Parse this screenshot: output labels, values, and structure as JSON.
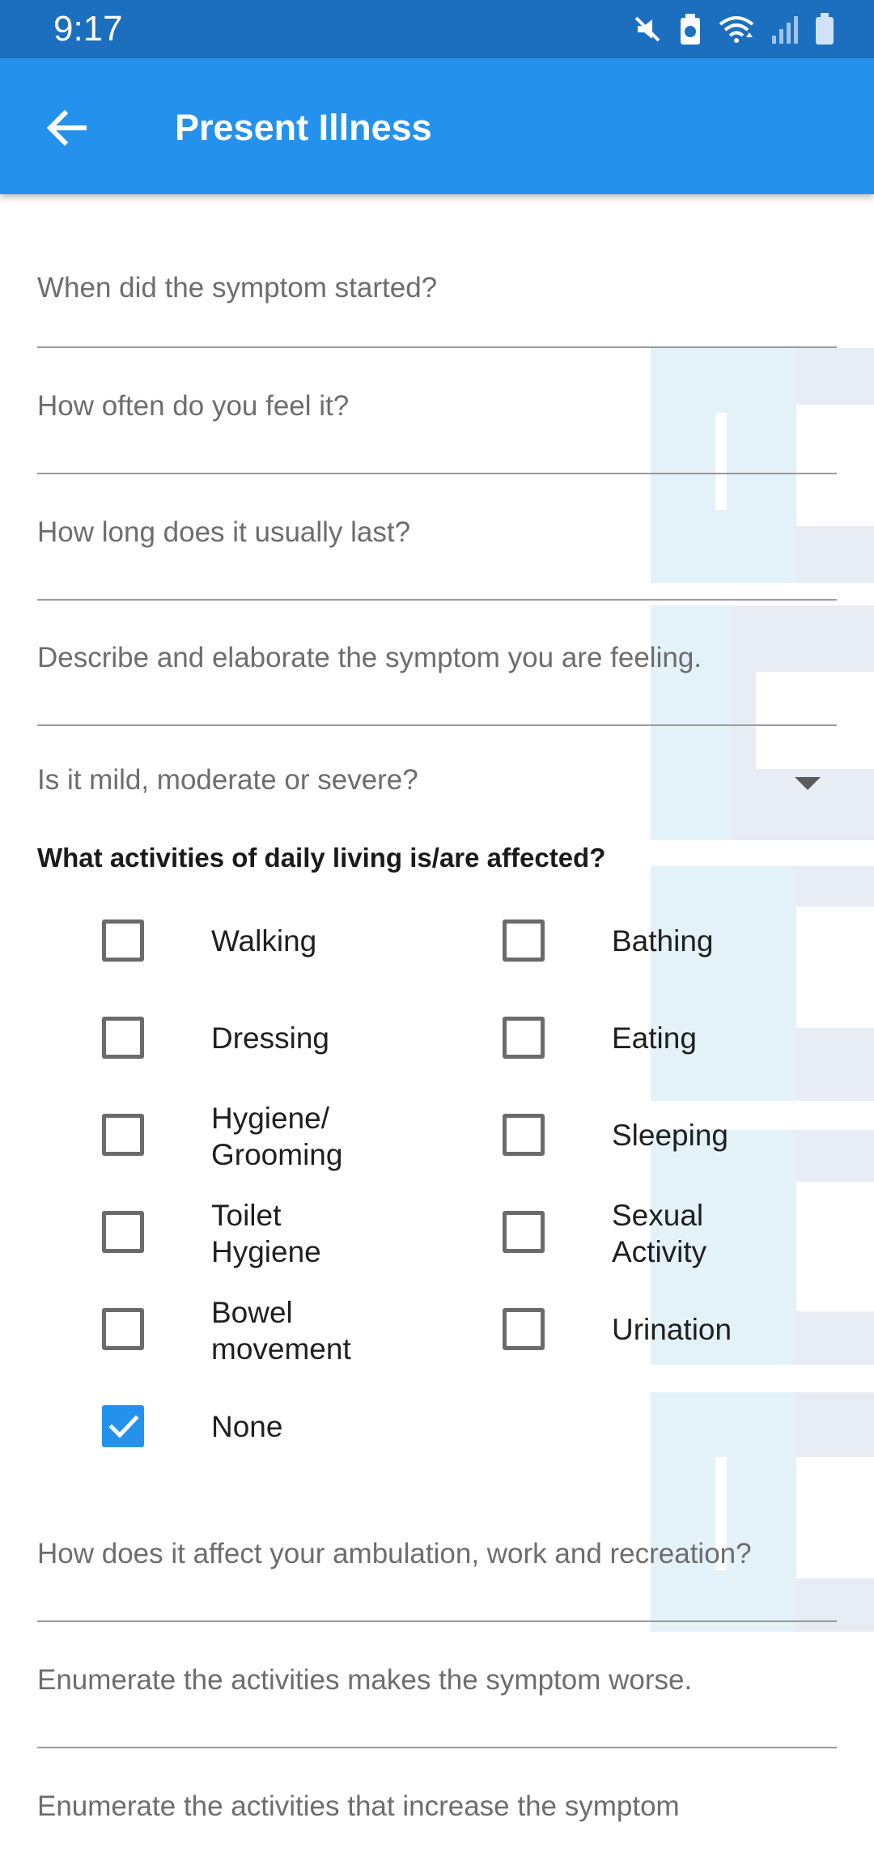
{
  "status_bar": {
    "time": "9:17",
    "icons": [
      "mute-icon",
      "battery-saver-icon",
      "wifi-icon",
      "signal-icon",
      "battery-icon"
    ]
  },
  "app_bar": {
    "title": "Present Illness",
    "back_icon": "back-arrow-icon"
  },
  "fields": {
    "symptom_started": {
      "placeholder": "When did the symptom started?",
      "value": ""
    },
    "how_often": {
      "placeholder": "How often do you feel it?",
      "value": ""
    },
    "how_long": {
      "placeholder": "How long does it usually last?",
      "value": ""
    },
    "describe": {
      "placeholder": "Describe and elaborate the symptom you are feeling.",
      "value": ""
    }
  },
  "severity_select": {
    "placeholder": "Is it mild, moderate or severe?",
    "selected": ""
  },
  "activities": {
    "title": "What activities of daily living is/are affected?",
    "items": [
      {
        "label": "Walking",
        "checked": false
      },
      {
        "label": "Bathing",
        "checked": false
      },
      {
        "label": "Dressing",
        "checked": false
      },
      {
        "label": "Eating",
        "checked": false
      },
      {
        "label": "Hygiene/ Grooming",
        "checked": false
      },
      {
        "label": "Sleeping",
        "checked": false
      },
      {
        "label": "Toilet Hygiene",
        "checked": false
      },
      {
        "label": "Sexual Activity",
        "checked": false
      },
      {
        "label": "Bowel movement",
        "checked": false
      },
      {
        "label": "Urination",
        "checked": false
      },
      {
        "label": "None",
        "checked": true
      }
    ]
  },
  "more_fields": {
    "affect_ambulation": {
      "placeholder": "How does it affect your ambulation, work and recreation?",
      "value": ""
    },
    "worse_activities": {
      "placeholder": "Enumerate the activities makes the symptom worse.",
      "value": ""
    },
    "next_partial": {
      "placeholder": "Enumerate the activities that increase the symptom",
      "value": ""
    }
  },
  "colors": {
    "status_bar": "#1c6fbe",
    "app_bar": "#2492ec",
    "checkbox_checked": "#2492ec"
  }
}
